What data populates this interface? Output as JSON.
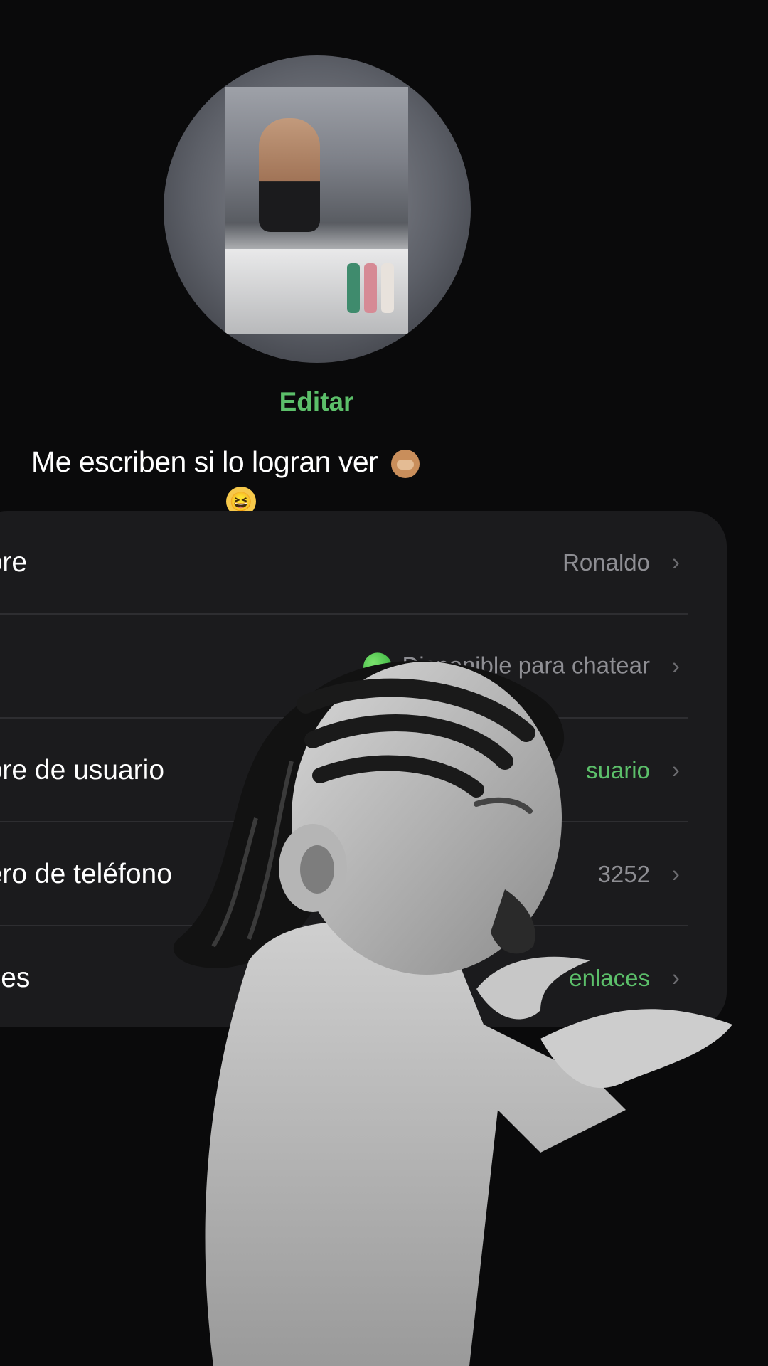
{
  "profile": {
    "edit_label": "Editar"
  },
  "caption": {
    "text": "Me escriben si lo logran ver",
    "emoji_inline": "see-no-evil-monkey",
    "emoji_line2": "😆"
  },
  "settings": {
    "rows": [
      {
        "label": "nbre",
        "value": "Ronaldo",
        "value_color": "gray"
      },
      {
        "label": ".",
        "value": "Disponible para chatear",
        "value_color": "gray"
      },
      {
        "label": "nbre de usuario",
        "value": "suario",
        "value_color": "green"
      },
      {
        "label": "nero de teléfono",
        "value": "3252",
        "value_color": "gray"
      },
      {
        "label": "aces",
        "value": "enlaces",
        "value_color": "green"
      }
    ]
  },
  "colors": {
    "background": "#0a0a0b",
    "card": "#1b1b1d",
    "accent_green": "#5cbf6a",
    "secondary_text": "#8e8e93"
  }
}
